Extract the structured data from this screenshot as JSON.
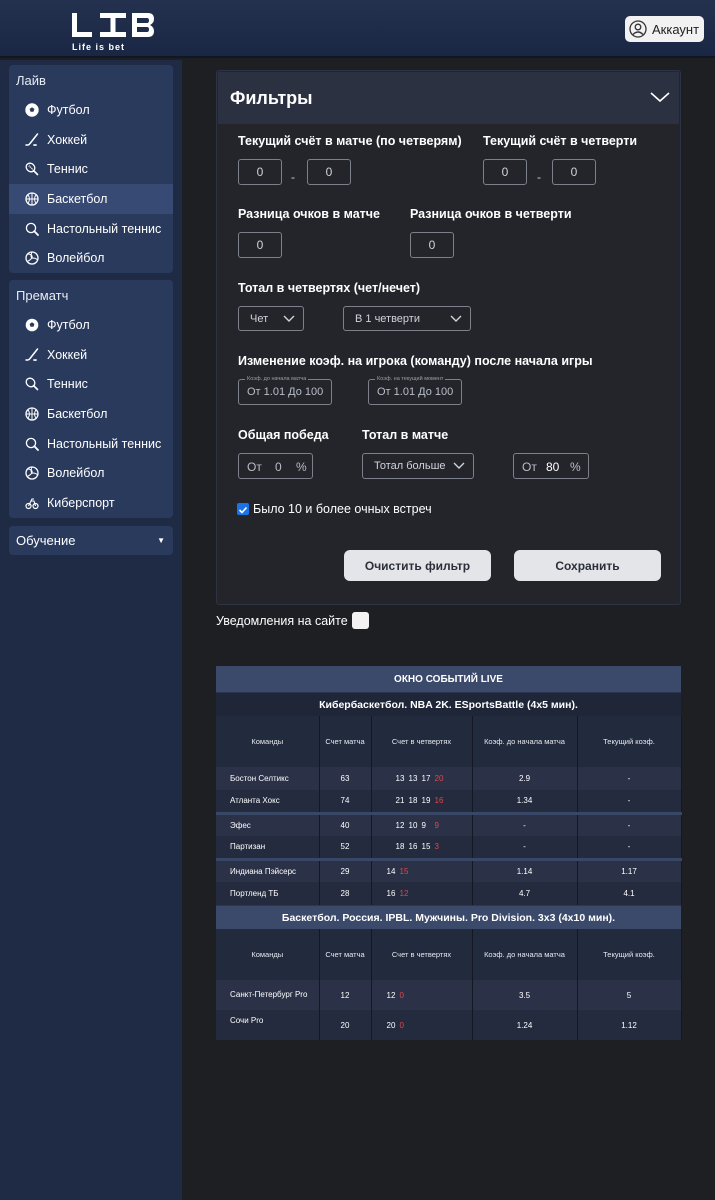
{
  "brand": {
    "subtitle": "Life is bet"
  },
  "account": {
    "label": "Аккаунт"
  },
  "sidebar": {
    "live": {
      "header": "Лайв",
      "items": [
        {
          "label": "Футбол",
          "icon": "football-icon",
          "active": false
        },
        {
          "label": "Хоккей",
          "icon": "hockey-icon",
          "active": false
        },
        {
          "label": "Теннис",
          "icon": "tennis-icon",
          "active": false
        },
        {
          "label": "Баскетбол",
          "icon": "basketball-icon",
          "active": true
        },
        {
          "label": "Настольный теннис",
          "icon": "table-tennis-icon",
          "active": false
        },
        {
          "label": "Волейбол",
          "icon": "volleyball-icon",
          "active": false
        }
      ]
    },
    "prematch": {
      "header": "Прематч",
      "items": [
        {
          "label": "Футбол",
          "icon": "football-icon"
        },
        {
          "label": "Хоккей",
          "icon": "hockey-icon"
        },
        {
          "label": "Теннис",
          "icon": "tennis-icon"
        },
        {
          "label": "Баскетбол",
          "icon": "basketball-icon"
        },
        {
          "label": "Настольный теннис",
          "icon": "table-tennis-icon"
        },
        {
          "label": "Волейбол",
          "icon": "volleyball-icon"
        },
        {
          "label": "Киберспорт",
          "icon": "esports-icon"
        }
      ]
    },
    "learning": {
      "label": "Обучение",
      "caret": "▼"
    }
  },
  "filters": {
    "title": "Фильтры",
    "score_match_label": "Текущий счёт в матче (по четверям)",
    "score_match_a": "0",
    "score_match_b": "0",
    "score_quarter_label": "Текущий счёт в четверти",
    "score_quarter_a": "0",
    "score_quarter_b": "0",
    "dash": "-",
    "diff_match_label": "Разница очков в матче",
    "diff_match_value": "0",
    "diff_quarter_label": "Разница очков в четверти",
    "diff_quarter_value": "0",
    "total_quarters_label": "Тотал в четвертях (чет/нечет)",
    "parity_select": "Чет",
    "quarter_select": "В 1 четверти",
    "odds_change_label": "Изменение коэф. на игрока (команду) после начала игры",
    "odds_start_legend": "Коэф. до начала матча",
    "odds_current_legend": "Коэф. на текущий момент",
    "from_label": "От",
    "to_label": "До",
    "odds_start_from": "1.01",
    "odds_start_to": "100",
    "odds_current_from": "1.01",
    "odds_current_to": "100",
    "overall_win_label": "Общая победа",
    "overall_win_value": "0",
    "percent": "%",
    "total_match_label": "Тотал в матче",
    "total_select": "Тотал больше",
    "total_pct_value": "80",
    "h2h_label": "Было 10 и более очных встреч",
    "h2h_checked": true,
    "clear_button": "Очистить фильтр",
    "save_button": "Сохранить"
  },
  "notifications": {
    "label": "Уведомления на сайте",
    "enabled": false
  },
  "live_window": {
    "title": "ОКНО СОБЫТИЙ LIVE",
    "columns": [
      "Команды",
      "Счет матча",
      "Счет в четвертях",
      "Коэф. до начала матча",
      "Текущий коэф."
    ],
    "sections": [
      {
        "name": "Кибербаскетбол. NBA 2K. ESportsBattle (4х5 мин).",
        "matches": [
          [
            {
              "team": "Бостон Селтикс",
              "score": "63",
              "quarters": [
                "13",
                "13",
                "17"
              ],
              "current_q": "20",
              "odds_start": "2.9",
              "odds_now": "-"
            },
            {
              "team": "Атланта Хокс",
              "score": "74",
              "quarters": [
                "21",
                "18",
                "19"
              ],
              "current_q": "16",
              "odds_start": "1.34",
              "odds_now": "-"
            }
          ],
          [
            {
              "team": "Эфес",
              "score": "40",
              "quarters": [
                "12",
                "10",
                "9"
              ],
              "current_q": "9",
              "odds_start": "-",
              "odds_now": "-"
            },
            {
              "team": "Партизан",
              "score": "52",
              "quarters": [
                "18",
                "16",
                "15"
              ],
              "current_q": "3",
              "odds_start": "-",
              "odds_now": "-"
            }
          ],
          [
            {
              "team": "Индиана Пэйсерс",
              "score": "29",
              "quarters": [
                "14"
              ],
              "current_q": "15",
              "odds_start": "1.14",
              "odds_now": "1.17"
            },
            {
              "team": "Портленд ТБ",
              "score": "28",
              "quarters": [
                "16"
              ],
              "current_q": "12",
              "odds_start": "4.7",
              "odds_now": "4.1"
            }
          ]
        ]
      },
      {
        "name": "Баскетбол. Россия. IPBL. Мужчины. Pro Division. 3х3 (4х10 мин).",
        "matches": [
          [
            {
              "team": "Санкт-Петербург Pro",
              "score": "12",
              "quarters": [
                "12"
              ],
              "current_q": "0",
              "odds_start": "3.5",
              "odds_now": "5"
            },
            {
              "team": "Сочи Pro",
              "score": "20",
              "quarters": [
                "20"
              ],
              "current_q": "0",
              "odds_start": "1.24",
              "odds_now": "1.12"
            }
          ]
        ]
      }
    ]
  }
}
